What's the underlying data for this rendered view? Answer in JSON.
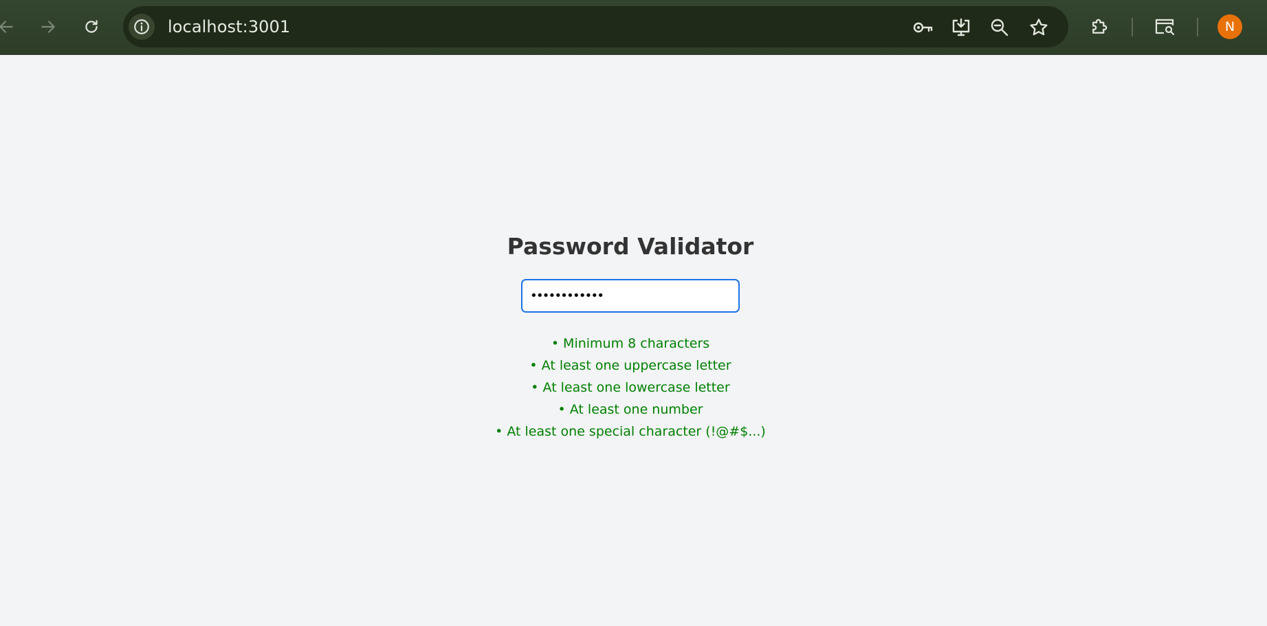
{
  "browser": {
    "url": "localhost:3001",
    "profile_initial": "N",
    "profile_color": "#e8710a",
    "icons": {
      "back": "back-arrow-icon",
      "forward": "forward-arrow-icon",
      "reload": "reload-icon",
      "site_info": "info-icon",
      "passwords": "key-icon",
      "install": "install-app-icon",
      "zoom": "zoom-out-icon",
      "bookmark": "star-icon",
      "extensions": "puzzle-icon",
      "search_tabs": "tab-search-icon"
    }
  },
  "page": {
    "title": "Password Validator",
    "password_value": "••••••••••••",
    "rules_color": "#008000",
    "rules": [
      {
        "text": "• Minimum 8 characters",
        "met": true
      },
      {
        "text": "• At least one uppercase letter",
        "met": true
      },
      {
        "text": "• At least one lowercase letter",
        "met": true
      },
      {
        "text": "• At least one number",
        "met": true
      },
      {
        "text": "• At least one special character (!@#$...)",
        "met": true
      }
    ]
  }
}
